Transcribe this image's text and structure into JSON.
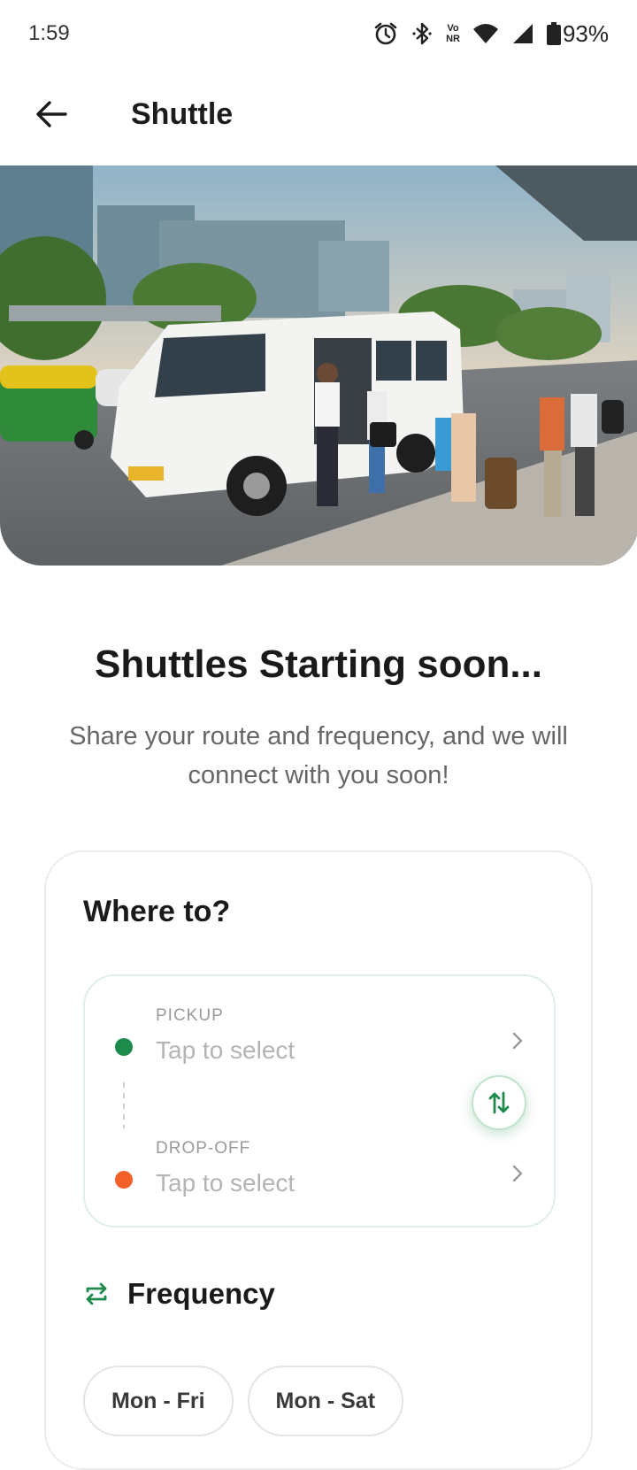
{
  "status_bar": {
    "time": "1:59",
    "volte_top": "Vo",
    "volte_bottom": "NR",
    "battery": "93%"
  },
  "app_bar": {
    "title": "Shuttle"
  },
  "hero": {
    "icon": "white-shuttle-van-photo"
  },
  "main": {
    "headline": "Shuttles Starting soon...",
    "subtext": "Share your route and frequency, and we will connect with you soon!"
  },
  "card": {
    "title": "Where to?",
    "pickup": {
      "label": "PICKUP",
      "value": "Tap to select"
    },
    "dropoff": {
      "label": "DROP-OFF",
      "value": "Tap to select"
    },
    "frequency_title": "Frequency",
    "chips": [
      "Mon - Fri",
      "Mon - Sat"
    ]
  },
  "colors": {
    "brand_green": "#1e8a4c",
    "dropoff_orange": "#f4602a"
  }
}
